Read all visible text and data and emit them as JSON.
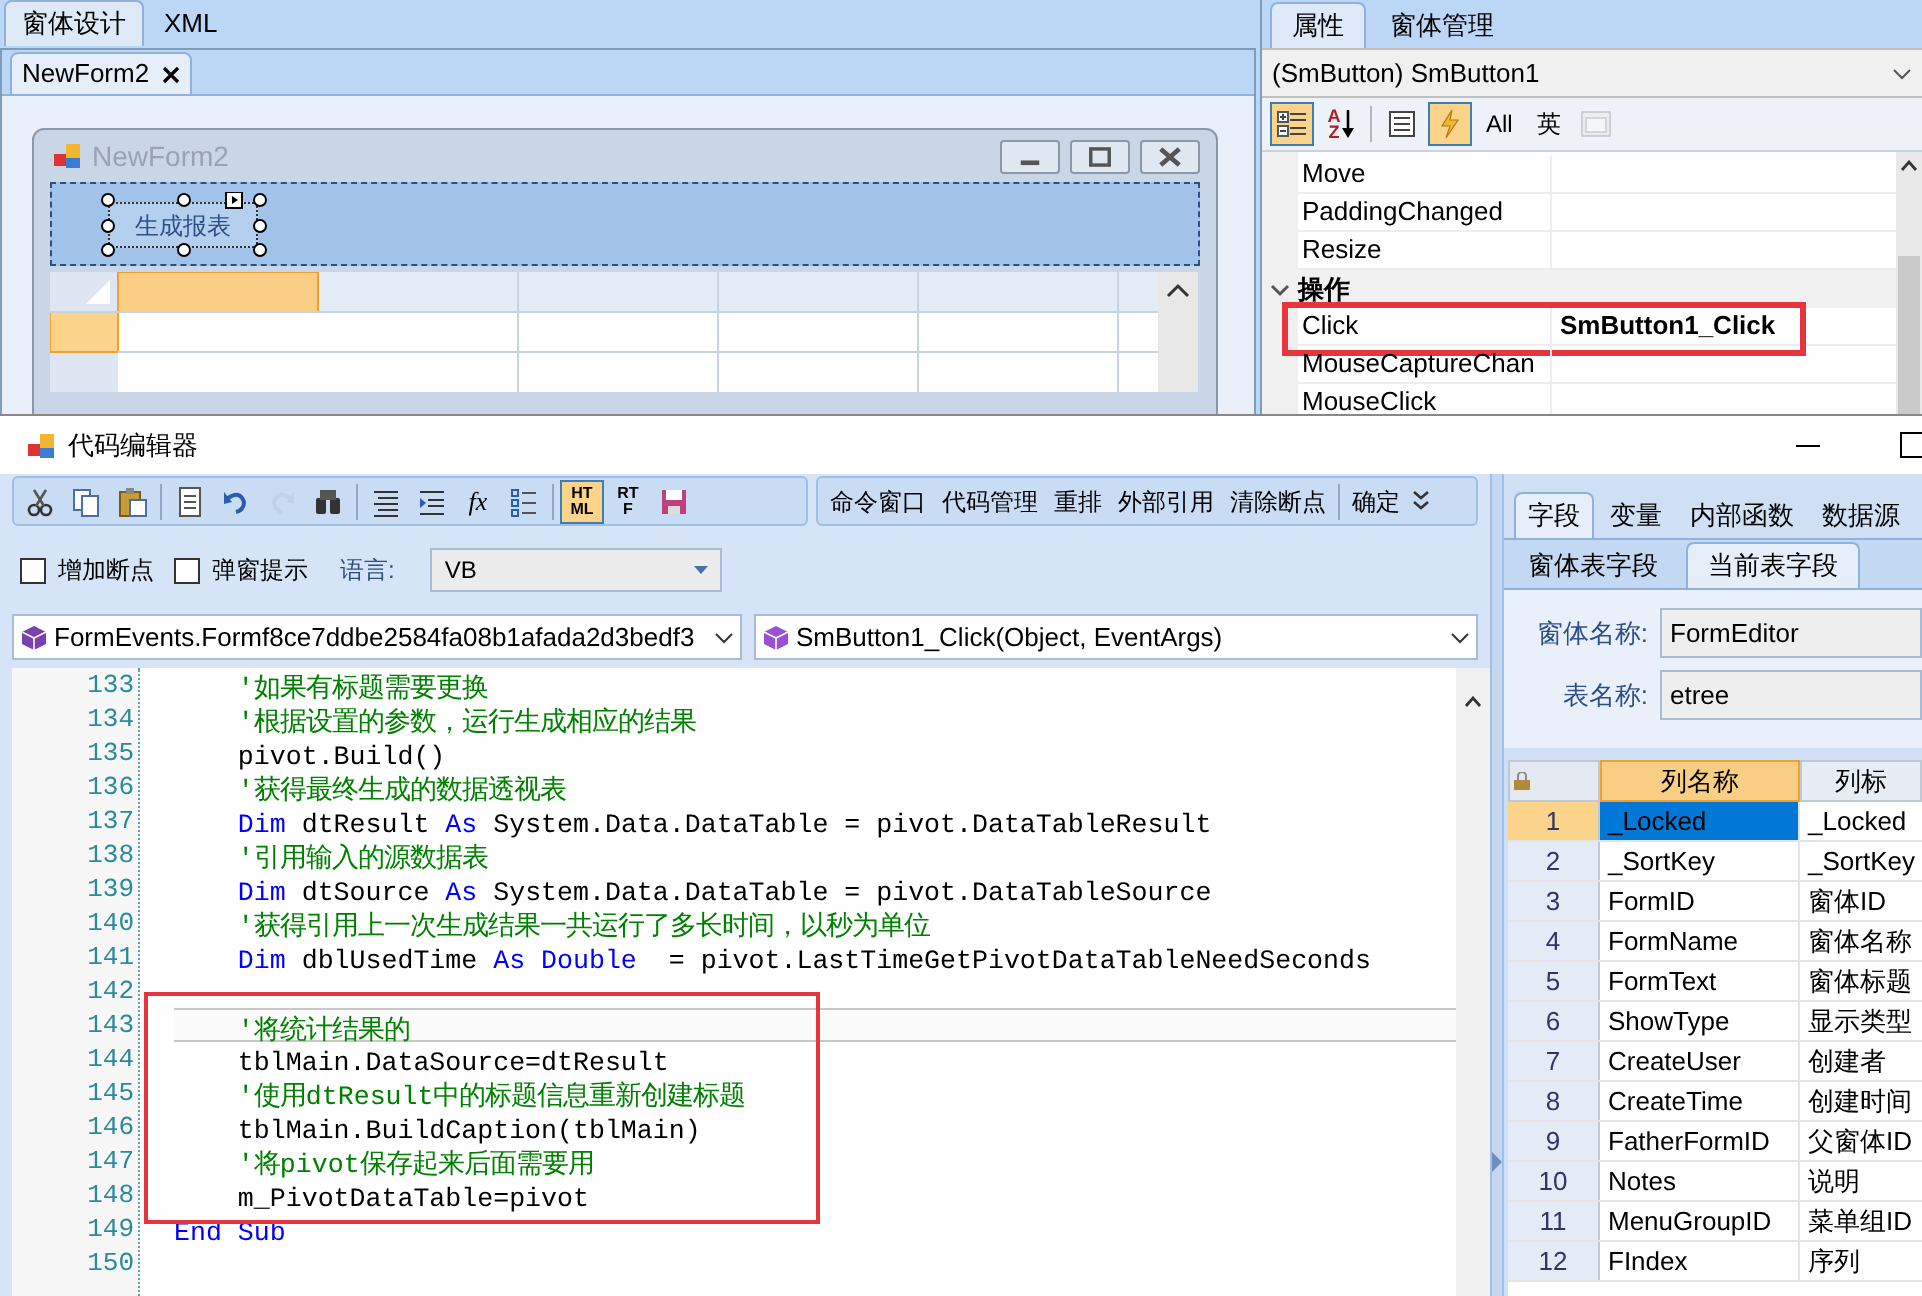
{
  "designer": {
    "tabs": [
      {
        "label": "窗体设计",
        "selected": true
      },
      {
        "label": "XML",
        "selected": false
      }
    ],
    "document_tabs": [
      {
        "label": "NewForm2",
        "selected": true
      }
    ],
    "form_preview": {
      "title": "NewForm2",
      "button": {
        "label": "生成报表",
        "selected": true
      }
    }
  },
  "properties": {
    "tabs": [
      {
        "label": "属性",
        "selected": true
      },
      {
        "label": "窗体管理",
        "selected": false
      }
    ],
    "object_selector": "(SmButton) SmButton1",
    "toolbar": [
      {
        "kind": "categorized",
        "selected": true,
        "disabled": false
      },
      {
        "kind": "alphabetical",
        "label": "AZ",
        "selected": false,
        "disabled": false
      },
      {
        "kind": "property-pages",
        "selected": false,
        "disabled": false
      },
      {
        "kind": "events",
        "selected": true,
        "disabled": false
      },
      {
        "kind": "text",
        "label": "All",
        "selected": false,
        "disabled": false
      },
      {
        "kind": "text",
        "label": "英",
        "selected": false,
        "disabled": false
      },
      {
        "kind": "pages",
        "selected": false,
        "disabled": true
      }
    ],
    "rows": [
      {
        "kind": "event",
        "name": "Move",
        "boxed": false
      },
      {
        "kind": "event",
        "name": "PaddingChanged",
        "boxed": false
      },
      {
        "kind": "event",
        "name": "Resize",
        "boxed": false
      },
      {
        "kind": "category",
        "name": "操作",
        "expanded": true
      },
      {
        "kind": "event",
        "name": "Click",
        "value": "SmButton1_Click",
        "boxed": true
      },
      {
        "kind": "event",
        "name": "MouseCaptureChan",
        "boxed": false
      },
      {
        "kind": "event",
        "name": "MouseClick",
        "boxed": false
      }
    ]
  },
  "code_editor": {
    "title": "代码编辑器",
    "toolbar": [
      {
        "kind": "cut",
        "selected": false,
        "disabled": false
      },
      {
        "kind": "copy",
        "selected": false,
        "disabled": false
      },
      {
        "kind": "paste",
        "selected": false,
        "disabled": false
      },
      {
        "kind": "document",
        "selected": false,
        "disabled": false
      },
      {
        "kind": "undo",
        "selected": false,
        "disabled": false
      },
      {
        "kind": "redo",
        "selected": false,
        "disabled": true
      },
      {
        "kind": "find",
        "selected": false,
        "disabled": false
      },
      {
        "kind": "align",
        "selected": false,
        "disabled": false
      },
      {
        "kind": "indent",
        "selected": false,
        "disabled": false
      },
      {
        "kind": "function",
        "label": "fx",
        "selected": false,
        "disabled": false
      },
      {
        "kind": "list",
        "selected": false,
        "disabled": false
      },
      {
        "kind": "html",
        "label": "HTML",
        "selected": true,
        "disabled": false
      },
      {
        "kind": "rtf",
        "label": "RTF",
        "selected": false,
        "disabled": false
      },
      {
        "kind": "save",
        "selected": false,
        "disabled": false
      }
    ],
    "command_buttons": [
      "命令窗口",
      "代码管理",
      "重排",
      "外部引用",
      "清除断点",
      "确定"
    ],
    "options": [
      {
        "label": "增加断点",
        "checked": false
      },
      {
        "label": "弹窗提示",
        "checked": false
      }
    ],
    "language": {
      "label": "语言:",
      "value": "VB"
    },
    "class_selector": "FormEvents.Formf8ce7ddbe2584fa08b1afada2d3bedf3",
    "method_selector": "SmButton1_Click(Object, EventArgs)",
    "lines": [
      {
        "number": "133",
        "current": false,
        "boxed": false,
        "tokens": [
          {
            "kind": "comment",
            "text": "    '如果有标题需要更换"
          }
        ]
      },
      {
        "number": "134",
        "current": false,
        "boxed": false,
        "tokens": [
          {
            "kind": "comment",
            "text": "    '根据设置的参数，运行生成相应的结果"
          }
        ]
      },
      {
        "number": "135",
        "current": false,
        "boxed": false,
        "tokens": [
          {
            "kind": "plain",
            "text": "    pivot.Build()"
          }
        ]
      },
      {
        "number": "136",
        "current": false,
        "boxed": false,
        "tokens": [
          {
            "kind": "comment",
            "text": "    '获得最终生成的数据透视表"
          }
        ]
      },
      {
        "number": "137",
        "current": false,
        "boxed": false,
        "tokens": [
          {
            "kind": "keyword",
            "text": "    Dim"
          },
          {
            "kind": "plain",
            "text": " dtResult "
          },
          {
            "kind": "keyword",
            "text": "As"
          },
          {
            "kind": "plain",
            "text": " System.Data.DataTable = pivot.DataTableResult"
          }
        ]
      },
      {
        "number": "138",
        "current": false,
        "boxed": false,
        "tokens": [
          {
            "kind": "comment",
            "text": "    '引用输入的源数据表"
          }
        ]
      },
      {
        "number": "139",
        "current": false,
        "boxed": false,
        "tokens": [
          {
            "kind": "keyword",
            "text": "    Dim"
          },
          {
            "kind": "plain",
            "text": " dtSource "
          },
          {
            "kind": "keyword",
            "text": "As"
          },
          {
            "kind": "plain",
            "text": " System.Data.DataTable = pivot.DataTableSource"
          }
        ]
      },
      {
        "number": "140",
        "current": false,
        "boxed": false,
        "tokens": [
          {
            "kind": "comment",
            "text": "    '获得引用上一次生成结果一共运行了多长时间，以秒为单位"
          }
        ]
      },
      {
        "number": "141",
        "current": false,
        "boxed": false,
        "tokens": [
          {
            "kind": "keyword",
            "text": "    Dim"
          },
          {
            "kind": "plain",
            "text": " dblUsedTime "
          },
          {
            "kind": "keyword",
            "text": "As Double"
          },
          {
            "kind": "plain",
            "text": "  = pivot.LastTimeGetPivotDataTableNeedSeconds"
          }
        ]
      },
      {
        "number": "142",
        "current": false,
        "boxed": false
      },
      {
        "number": "143",
        "current": true,
        "boxed": true,
        "tokens": [
          {
            "kind": "comment",
            "text": "    '将统计结果的"
          }
        ]
      },
      {
        "number": "144",
        "current": false,
        "boxed": true,
        "tokens": [
          {
            "kind": "plain",
            "text": "    tblMain.DataSource=dtResult"
          }
        ]
      },
      {
        "number": "145",
        "current": false,
        "boxed": true,
        "tokens": [
          {
            "kind": "comment",
            "text": "    '使用dtResult中的标题信息重新创建标题"
          }
        ]
      },
      {
        "number": "146",
        "current": false,
        "boxed": true,
        "tokens": [
          {
            "kind": "plain",
            "text": "    tblMain.BuildCaption(tblMain)"
          }
        ]
      },
      {
        "number": "147",
        "current": false,
        "boxed": true,
        "tokens": [
          {
            "kind": "comment",
            "text": "    '将pivot保存起来后面需要用"
          }
        ]
      },
      {
        "number": "148",
        "current": false,
        "boxed": true,
        "tokens": [
          {
            "kind": "plain",
            "text": "    m_PivotDataTable=pivot"
          }
        ]
      },
      {
        "number": "149",
        "current": false,
        "boxed": false,
        "tokens": [
          {
            "kind": "keyword",
            "text": "End Sub"
          }
        ]
      },
      {
        "number": "150",
        "current": false,
        "boxed": false
      }
    ]
  },
  "fields_panel": {
    "tabs": [
      {
        "label": "字段",
        "selected": true
      },
      {
        "label": "变量",
        "selected": false
      },
      {
        "label": "内部函数",
        "selected": false
      },
      {
        "label": "数据源",
        "selected": false
      }
    ],
    "sub_tabs": [
      {
        "label": "窗体表字段",
        "selected": false
      },
      {
        "label": "当前表字段",
        "selected": true
      }
    ],
    "form_name": {
      "label": "窗体名称:",
      "value": "FormEditor"
    },
    "table_name": {
      "label": "表名称:",
      "value": "etree"
    },
    "columns": [
      "列名称",
      "列标"
    ],
    "rows": [
      {
        "index": "1",
        "name": "_Locked",
        "caption": "_Locked",
        "selected": true
      },
      {
        "index": "2",
        "name": "_SortKey",
        "caption": "_SortKey",
        "selected": false
      },
      {
        "index": "3",
        "name": "FormID",
        "caption": "窗体ID",
        "selected": false
      },
      {
        "index": "4",
        "name": "FormName",
        "caption": "窗体名称",
        "selected": false
      },
      {
        "index": "5",
        "name": "FormText",
        "caption": "窗体标题",
        "selected": false
      },
      {
        "index": "6",
        "name": "ShowType",
        "caption": "显示类型",
        "selected": false
      },
      {
        "index": "7",
        "name": "CreateUser",
        "caption": "创建者",
        "selected": false
      },
      {
        "index": "8",
        "name": "CreateTime",
        "caption": "创建时间",
        "selected": false
      },
      {
        "index": "9",
        "name": "FatherFormID",
        "caption": "父窗体ID",
        "selected": false
      },
      {
        "index": "10",
        "name": "Notes",
        "caption": "说明",
        "selected": false
      },
      {
        "index": "11",
        "name": "MenuGroupID",
        "caption": "菜单组ID",
        "selected": false
      },
      {
        "index": "12",
        "name": "FIndex",
        "caption": "序列",
        "selected": false
      }
    ]
  }
}
